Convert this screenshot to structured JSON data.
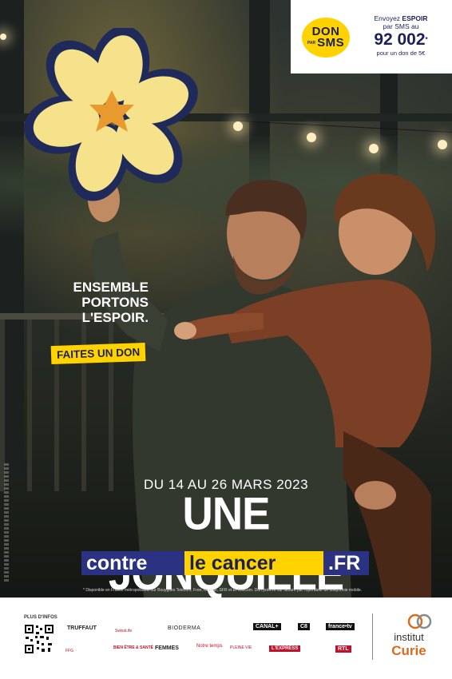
{
  "sms_box": {
    "badge_main": "DON",
    "badge_prefix": "PAR",
    "badge_sms": "SMS",
    "line1": "Envoyez ",
    "line1_bold": "ESPOIR",
    "line2": "par SMS au",
    "number": "92 002",
    "number_mark": "*",
    "line3": "pour un don de 5€"
  },
  "tagline": {
    "line1": "ENSEMBLE",
    "line2": "PORTONS",
    "line3": "L'ESPOIR."
  },
  "cta_label": "FAITES UN DON",
  "dates": "DU 14 AU 26 MARS 2023",
  "headline": "UNE JONQUILLE",
  "url": {
    "part1": "contre",
    "part2": "le cancer",
    "part3": ".FR"
  },
  "footnote": "* Disponible en France métropolitaine sur Bouygues Telecom, Free, Orange, SFR et El Telecom. Don prélevé sur facture par l'opérateur de téléphonie mobile.",
  "footer": {
    "plus_infos": "PLUS D'INFOS",
    "partners_row1": [
      "TRUFFAUT",
      "SwissLife",
      "BIODERMA",
      "CANAL+",
      "C8",
      "france•tv"
    ],
    "partners_row2": [
      "FFG",
      "BIEN ÊTRE & SANTÉ",
      "FEMMES",
      "Notre temps",
      "PLEINE VIE",
      "L'EXPRESS",
      "RTL"
    ],
    "brand_line1": "institut",
    "brand_line2": "Curie"
  },
  "colors": {
    "yellow": "#ffd200",
    "navy": "#2b3282",
    "curie_orange": "#d96b1e"
  }
}
